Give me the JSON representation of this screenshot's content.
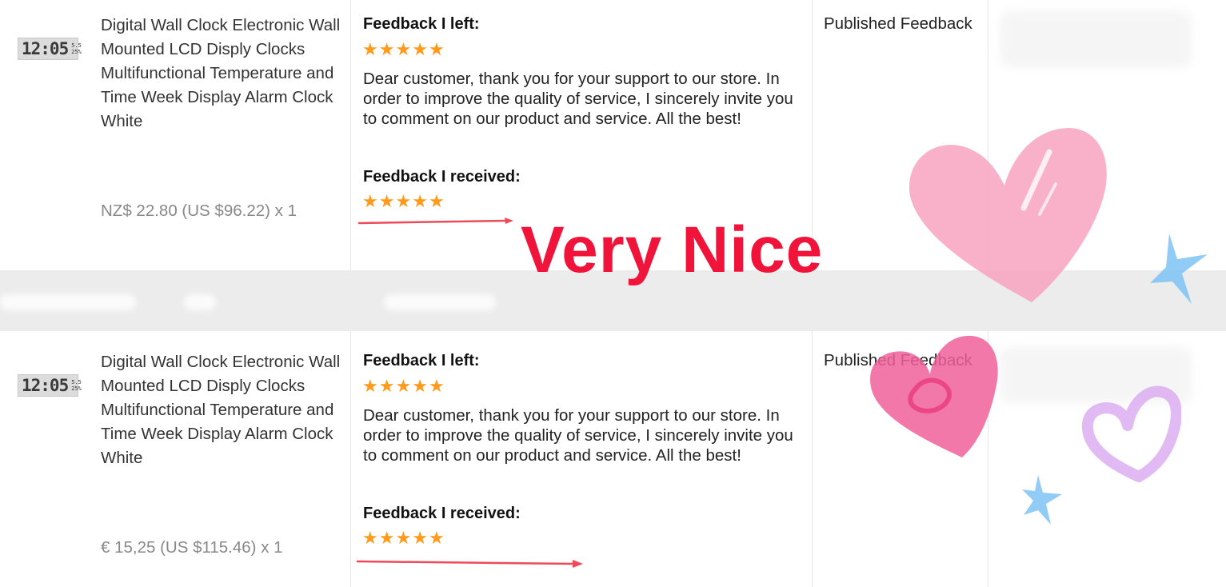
{
  "orders": [
    {
      "thumbnail": {
        "clock_time": "12:05",
        "mini_top": "5.5",
        "mini_bottom": "25%"
      },
      "title": "Digital Wall Clock Electronic Wall Mounted LCD Disply Clocks Multifunctional Temperature and Time Week Display Alarm Clock White",
      "price": "NZ$ 22.80 (US $96.22) x 1",
      "feedback_left_label": "Feedback I left:",
      "feedback_left_rating": 5,
      "feedback_left_text": "Dear customer, thank you for your support to our store. In order to improve the quality of service, I sincerely invite you to comment on our product and service. All the best!",
      "feedback_received_label": "Feedback I received:",
      "feedback_received_rating": 5,
      "status": "Published Feedback"
    },
    {
      "thumbnail": {
        "clock_time": "12:05",
        "mini_top": "5.5",
        "mini_bottom": "25%"
      },
      "title": "Digital Wall Clock Electronic Wall Mounted LCD Disply Clocks Multifunctional Temperature and Time Week Display Alarm Clock White",
      "price": "€ 15,25 (US $115.46) x 1",
      "feedback_left_label": "Feedback I left:",
      "feedback_left_rating": 5,
      "feedback_left_text": "Dear customer, thank you for your support to our store. In order to improve the quality of service, I sincerely invite you to comment on our product and service. All the best!",
      "feedback_received_label": "Feedback I received:",
      "feedback_received_rating": 5,
      "status": "Published Feedback"
    }
  ],
  "overlay": {
    "caption": "Very Nice"
  },
  "colors": {
    "star": "#ff9a1a",
    "caption": "#f0143a",
    "arrow": "#ee4a5a",
    "heart_pink": "#f7a3c0",
    "heart_magenta": "#f0609a",
    "heart_lavender": "#d9a8f0",
    "sparkle_blue": "#7ec3f5"
  },
  "icons": [
    "clock-thumbnail",
    "star-icon",
    "red-arrow-icon",
    "heart-sticker-icon",
    "sparkle-sticker-icon"
  ]
}
